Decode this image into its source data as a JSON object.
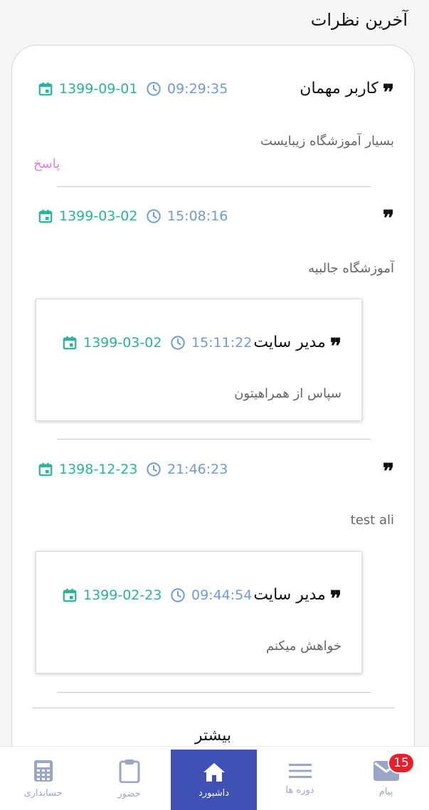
{
  "page_title": "آخرین نظرات",
  "comments": [
    {
      "author": "کاربر مهمان",
      "time": "09:29:35",
      "date": "1399-09-01",
      "text": "بسیار آموزشگاه زیبایست",
      "reply_link": "پاسخ"
    },
    {
      "author": "",
      "time": "15:08:16",
      "date": "1399-03-02",
      "text": "آموزشگاه جالبیه",
      "reply": {
        "author": "مدیر سایت",
        "time": "15:11:22",
        "date": "1399-03-02",
        "text": "سپاس از همراهیتون"
      }
    },
    {
      "author": "",
      "time": "21:46:23",
      "date": "1398-12-23",
      "text": "test ali",
      "reply": {
        "author": "مدیر سایت",
        "time": "09:44:54",
        "date": "1399-02-23",
        "text": "خواهش میکنم"
      }
    }
  ],
  "more_label": "بیشتر",
  "tabbar": {
    "tabs": [
      {
        "label": "حسابداری",
        "icon": "calculator-icon"
      },
      {
        "label": "حضور",
        "icon": "clipboard-icon"
      },
      {
        "label": "داشبورد",
        "icon": "home-icon",
        "active": true
      },
      {
        "label": "دوره ها",
        "icon": "menu-icon"
      },
      {
        "label": "پیام",
        "icon": "mail-icon",
        "badge": "15"
      }
    ]
  },
  "colors": {
    "date": "#29b39a",
    "time": "#6f9bd6",
    "reply_link": "#de7fe3",
    "active_tab": "#3f51b5",
    "badge": "#e81e2a"
  }
}
